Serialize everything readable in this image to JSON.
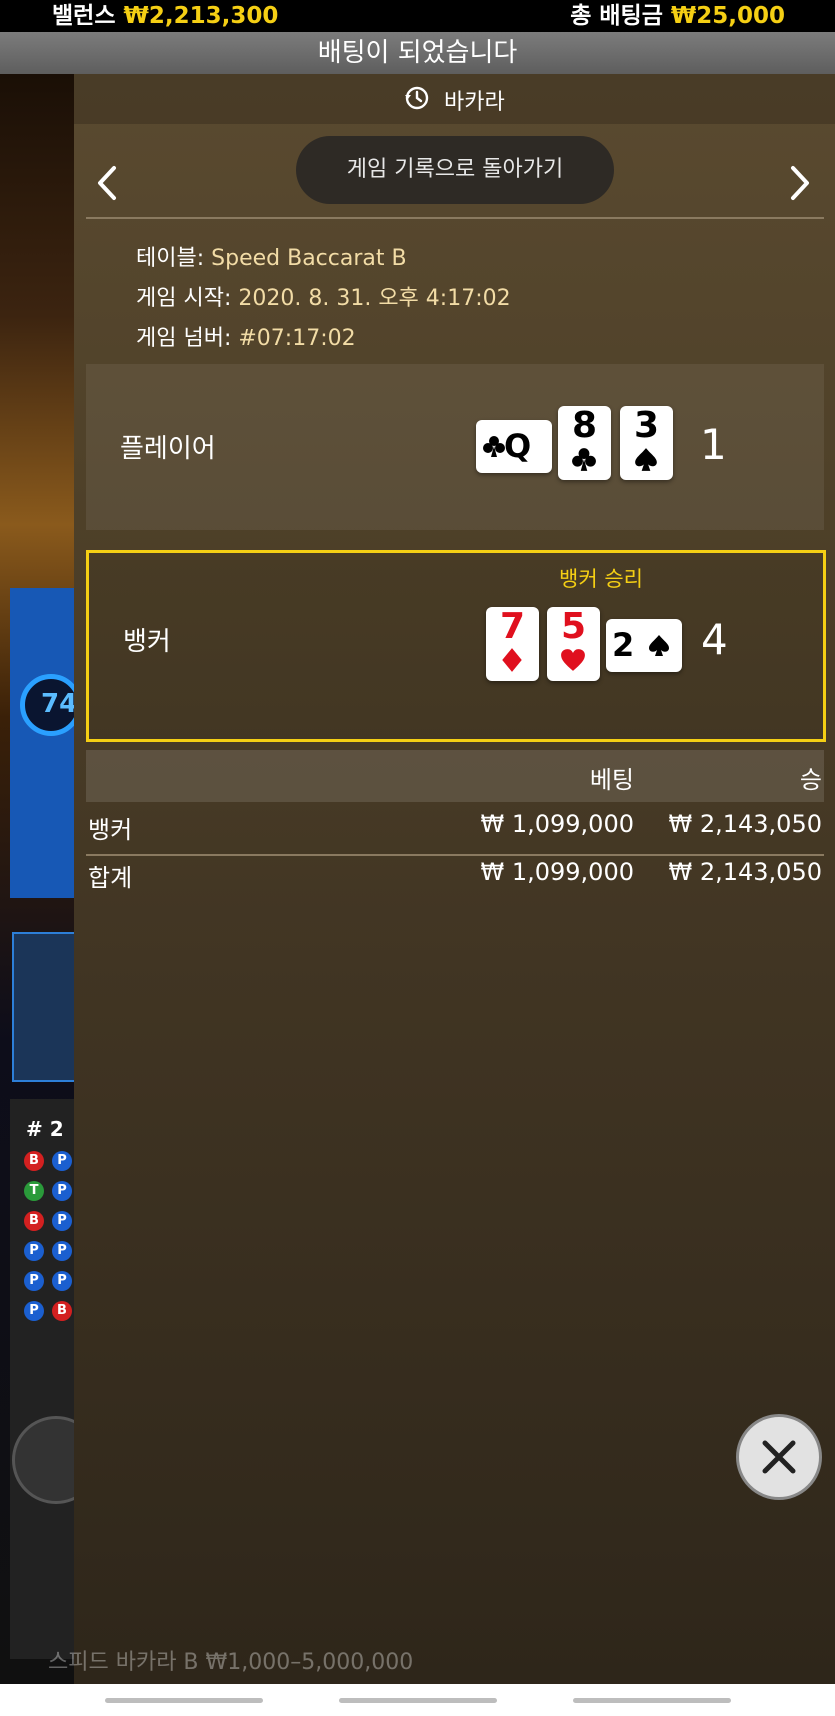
{
  "top": {
    "balance_label": "밸런스",
    "balance_value": "₩2,213,300",
    "total_bet_label": "총 배팅금",
    "total_bet_value": "₩25,000",
    "banner": "배팅이 되었습니다"
  },
  "background": {
    "timer_text": "74",
    "road_header": "# 2",
    "caption": "스피드 바카라 B  ₩1,000–5,000,000"
  },
  "panel": {
    "title": "바카라",
    "back_label": "게임 기록으로 돌아가기",
    "info": {
      "table_label": "테이블:",
      "table_value": "Speed Baccarat B",
      "start_label": "게임 시작:",
      "start_value": "2020. 8. 31. 오후 4:17:02",
      "number_label": "게임 넘버:",
      "number_value": "#07:17:02"
    },
    "player": {
      "label": "플레이어",
      "total": "1",
      "cards": [
        {
          "rank": "Q",
          "suit": "club",
          "orientation": "sideways"
        },
        {
          "rank": "8",
          "suit": "club"
        },
        {
          "rank": "3",
          "suit": "spade"
        }
      ]
    },
    "banker": {
      "label": "뱅커",
      "total": "4",
      "result": "뱅커 승리",
      "cards": [
        {
          "rank": "7",
          "suit": "diamond"
        },
        {
          "rank": "5",
          "suit": "heart"
        },
        {
          "rank": "2",
          "suit": "spade",
          "orientation": "sideways"
        }
      ]
    },
    "bets": {
      "headers": [
        "",
        "베팅",
        "승"
      ],
      "rows": [
        [
          "뱅커",
          "₩ 1,099,000",
          "₩ 2,143,050"
        ],
        [
          "합계",
          "₩ 1,099,000",
          "₩ 2,143,050"
        ]
      ]
    }
  },
  "colors": {
    "accent_yellow": "#f5cf14",
    "info_value": "#f2dca6",
    "red_suit": "#e0101e"
  },
  "icons": [
    "history-icon",
    "chevron-left-icon",
    "chevron-right-icon",
    "close-icon"
  ]
}
